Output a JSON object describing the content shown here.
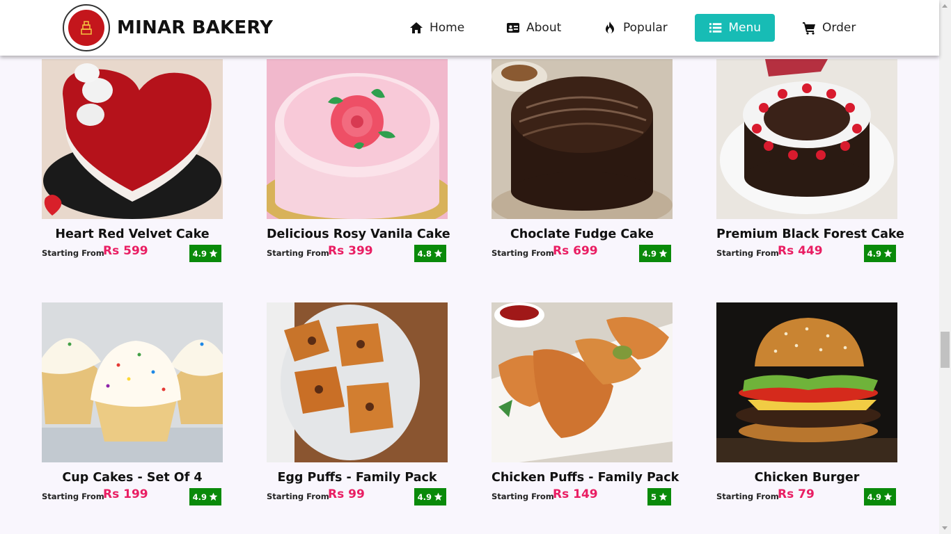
{
  "brand": {
    "name": "MINAR BAKERY",
    "logo_icon": "bakery-cake-logo"
  },
  "nav": [
    {
      "label": "Home",
      "icon": "home-icon"
    },
    {
      "label": "About",
      "icon": "id-card-icon"
    },
    {
      "label": "Popular",
      "icon": "fire-icon"
    },
    {
      "label": "Menu",
      "icon": "list-icon",
      "active": true
    },
    {
      "label": "Order",
      "icon": "cart-icon"
    }
  ],
  "colors": {
    "accent": "#17bcb5",
    "price": "#e91e63",
    "rating_bg": "#0a8a0a"
  },
  "products": [
    {
      "name": "Heart Red Velvet Cake",
      "from": "Starting From",
      "price": "Rs 599",
      "rating": "4.9"
    },
    {
      "name": "Delicious Rosy Vanila Cake",
      "from": "Starting From",
      "price": "Rs 399",
      "rating": "4.8"
    },
    {
      "name": "Choclate Fudge Cake",
      "from": "Starting From",
      "price": "Rs 699",
      "rating": "4.9"
    },
    {
      "name": "Premium Black Forest Cake",
      "from": "Starting From",
      "price": "Rs 449",
      "rating": "4.9"
    },
    {
      "name": "Cup Cakes - Set Of 4",
      "from": "Starting From",
      "price": "Rs 199",
      "rating": "4.9"
    },
    {
      "name": "Egg Puffs - Family Pack",
      "from": "Starting From",
      "price": "Rs 99",
      "rating": "4.9"
    },
    {
      "name": "Chicken Puffs - Family Pack",
      "from": "Starting From",
      "price": "Rs 149",
      "rating": "5"
    },
    {
      "name": "Chicken Burger",
      "from": "Starting From",
      "price": "Rs 79",
      "rating": "4.9"
    }
  ]
}
